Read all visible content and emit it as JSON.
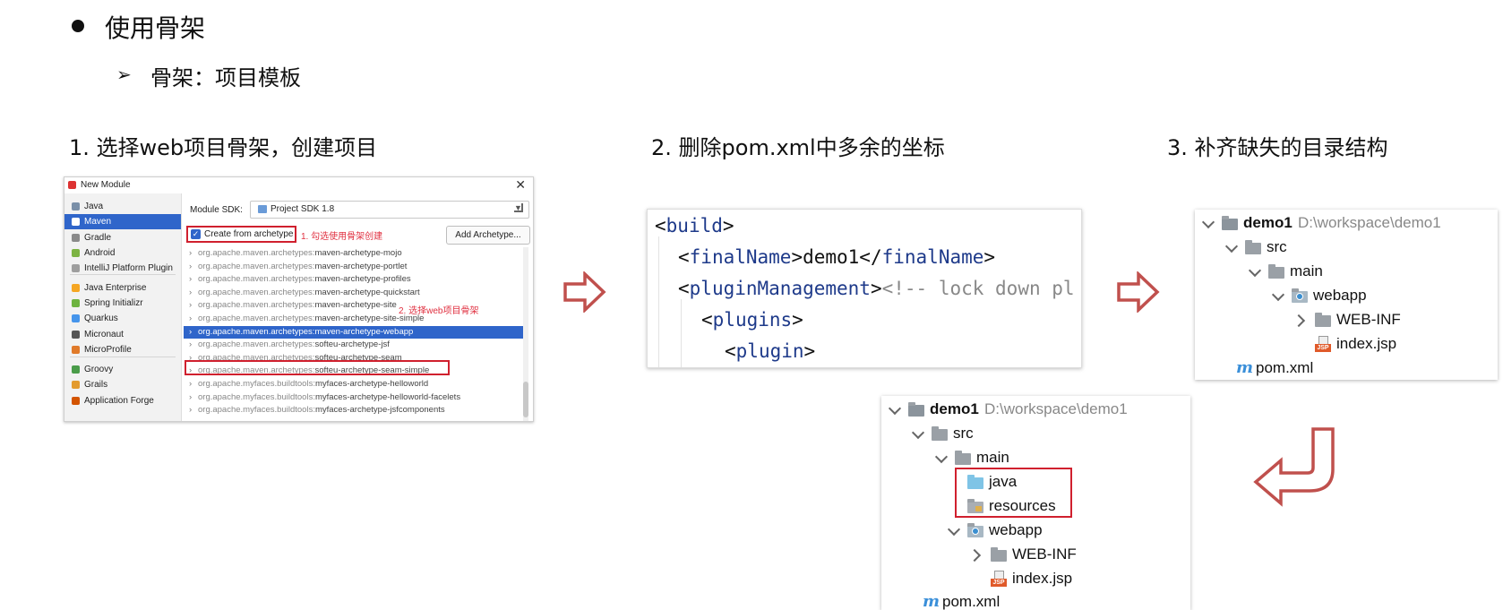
{
  "header": {
    "title": "使用骨架",
    "subtitle": "骨架：项目模板"
  },
  "steps": [
    {
      "label": "1. 选择web项目骨架，创建项目"
    },
    {
      "label": "2. 删除pom.xml中多余的坐标"
    },
    {
      "label": "3. 补齐缺失的目录结构"
    }
  ],
  "dialog": {
    "title": "New Module",
    "close": "✕",
    "sidebar": [
      {
        "label": "Java",
        "icon": "java-module-icon",
        "color": "#7a8fa8"
      },
      {
        "label": "Maven",
        "icon": "maven-icon",
        "color": "#ffffff",
        "selected": true
      },
      {
        "label": "Gradle",
        "icon": "gradle-icon",
        "color": "#8a8a8a"
      },
      {
        "label": "Android",
        "icon": "android-icon",
        "color": "#7cb342"
      },
      {
        "label": "IntelliJ Platform Plugin",
        "icon": "plugin-icon",
        "color": "#9e9e9e"
      },
      {
        "label": "Java Enterprise",
        "icon": "java-enterprise-icon",
        "color": "#f5a623"
      },
      {
        "label": "Spring Initializr",
        "icon": "spring-icon",
        "color": "#6db33f"
      },
      {
        "label": "Quarkus",
        "icon": "quarkus-icon",
        "color": "#4695eb"
      },
      {
        "label": "Micronaut",
        "icon": "micronaut-icon",
        "color": "#555555"
      },
      {
        "label": "MicroProfile",
        "icon": "microprofile-icon",
        "color": "#e07a2a"
      },
      {
        "label": "Groovy",
        "icon": "groovy-icon",
        "color": "#4a9c4a"
      },
      {
        "label": "Grails",
        "icon": "grails-icon",
        "color": "#e39b2f"
      },
      {
        "label": "Application Forge",
        "icon": "forge-icon",
        "color": "#d35400"
      }
    ],
    "sdk_label": "Module SDK:",
    "sdk_value": "Project SDK 1.8",
    "create_from_archetype": "Create from archetype",
    "annotation_1": "1. 勾选使用骨架创建",
    "add_archetype": "Add Archetype...",
    "annotation_2": "2. 选择web项目骨架",
    "archetypes": [
      {
        "prefix": "org.apache.maven.archetypes:",
        "name": "maven-archetype-mojo"
      },
      {
        "prefix": "org.apache.maven.archetypes:",
        "name": "maven-archetype-portlet"
      },
      {
        "prefix": "org.apache.maven.archetypes:",
        "name": "maven-archetype-profiles"
      },
      {
        "prefix": "org.apache.maven.archetypes:",
        "name": "maven-archetype-quickstart"
      },
      {
        "prefix": "org.apache.maven.archetypes:",
        "name": "maven-archetype-site"
      },
      {
        "prefix": "org.apache.maven.archetypes:",
        "name": "maven-archetype-site-simple"
      },
      {
        "prefix": "org.apache.maven.archetypes:",
        "name": "maven-archetype-webapp",
        "selected": true
      },
      {
        "prefix": "org.apache.maven.archetypes:",
        "name": "softeu-archetype-jsf"
      },
      {
        "prefix": "org.apache.maven.archetypes:",
        "name": "softeu-archetype-seam"
      },
      {
        "prefix": "org.apache.maven.archetypes:",
        "name": "softeu-archetype-seam-simple"
      },
      {
        "prefix": "org.apache.myfaces.buildtools:",
        "name": "myfaces-archetype-helloworld"
      },
      {
        "prefix": "org.apache.myfaces.buildtools:",
        "name": "myfaces-archetype-helloworld-facelets"
      },
      {
        "prefix": "org.apache.myfaces.buildtools:",
        "name": "myfaces-archetype-jsfcomponents"
      }
    ]
  },
  "code": {
    "l1_open": "<",
    "l1_tag": "build",
    "l1_close": ">",
    "l2_open": "<",
    "l2_tag": "finalName",
    "l2_mid": ">demo1</",
    "l2_tag2": "finalName",
    "l2_close": ">",
    "l3_open": "<",
    "l3_tag": "pluginManagement",
    "l3_close": ">",
    "l3_comment": "<!-- lock down pl",
    "l4_open": "<",
    "l4_tag": "plugins",
    "l4_close": ">",
    "l5_open": "<",
    "l5_tag": "plugin",
    "l5_close": ">"
  },
  "tree_top": {
    "project": "demo1",
    "path": "D:\\workspace\\demo1",
    "src": "src",
    "main": "main",
    "webapp": "webapp",
    "webinf": "WEB-INF",
    "indexjsp": "index.jsp",
    "pom": "pom.xml",
    "jsp_badge": "JSP",
    "maven_badge": "m"
  },
  "tree_bottom": {
    "project": "demo1",
    "path": "D:\\workspace\\demo1",
    "src": "src",
    "main": "main",
    "java": "java",
    "resources": "resources",
    "webapp": "webapp",
    "webinf": "WEB-INF",
    "indexjsp": "index.jsp",
    "pom": "pom.xml",
    "jsp_badge": "JSP",
    "maven_badge": "m"
  },
  "colors": {
    "accent_red": "#d0202e",
    "selection_blue": "#2f65ca",
    "arrow_red": "#c0504d"
  }
}
